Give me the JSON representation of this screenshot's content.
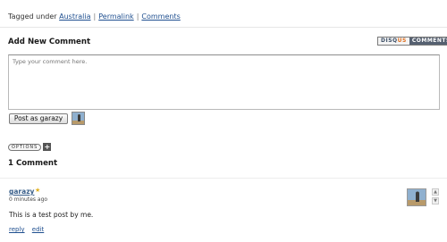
{
  "post_meta": {
    "tagged_prefix": "Tagged under",
    "tag_link": "Australia",
    "permalink": "Permalink",
    "comments_link": "Comments",
    "separator": "|"
  },
  "comment_form": {
    "title": "Add New Comment",
    "placeholder": "Type your comment here.",
    "post_button": "Post as garazy",
    "options_label": "OPTIONS",
    "options_toggle": "+"
  },
  "badge": {
    "disq": "DISQ",
    "us": "US",
    "comments": "COMMENTS"
  },
  "comments_header": {
    "count_text": "1 Comment"
  },
  "comments": [
    {
      "author": "garazy",
      "star": "★",
      "time": "0 minutes ago",
      "body": "This is a test post by me.",
      "reply": "reply",
      "edit": "edit"
    }
  ],
  "colors": {
    "link": "#1f4f8f",
    "author": "#3a5f8a",
    "badge_dark": "#556070",
    "badge_accent": "#e07020",
    "star": "#e0b020"
  },
  "icons": {
    "avatar": "user-avatar-photo",
    "vote_up": "vote-up-icon",
    "vote_down": "vote-down-icon"
  }
}
